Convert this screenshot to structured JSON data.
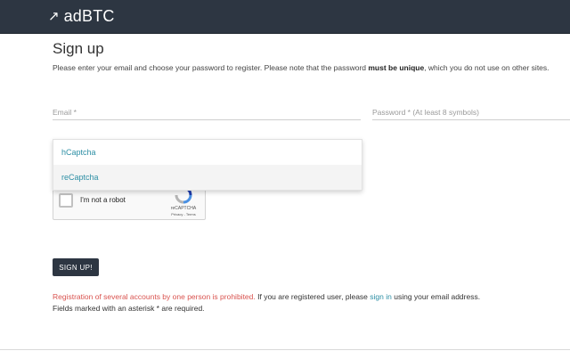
{
  "header": {
    "logo_symbol": "↗",
    "title": "adBTC"
  },
  "signup": {
    "title": "Sign up",
    "intro_start": "Please enter your email and choose your password to register. Please note that the password ",
    "intro_bold": "must be unique",
    "intro_end": ", which you do not use on other sites."
  },
  "form": {
    "email_placeholder": "Email *",
    "password_placeholder": "Password * (At least 8 symbols)"
  },
  "captcha_menu": {
    "options": [
      {
        "label": "hCaptcha"
      },
      {
        "label": "reCaptcha"
      }
    ]
  },
  "recaptcha": {
    "label": "I'm not a robot",
    "brand": "reCAPTCHA",
    "links": "Privacy - Terms"
  },
  "buttons": {
    "signup": "SIGN UP!"
  },
  "notes": {
    "warning": "Registration of several accounts by one person is prohibited.",
    "registered_start": " If you are registered user, please ",
    "signin_link": "sign in",
    "registered_end": " using your email address.",
    "required": "Fields marked with an asterisk * are required."
  },
  "colors": {
    "header_bg": "#2d3642",
    "link": "#2e8fa5",
    "warning": "#d9534f",
    "button_bg": "#2d3642"
  }
}
